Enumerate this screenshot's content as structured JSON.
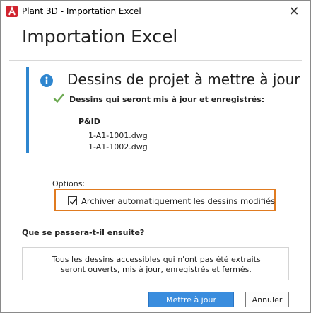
{
  "window": {
    "title": "Plant 3D - Importation Excel",
    "close_symbol": "✕"
  },
  "page_title": "Importation Excel",
  "info": {
    "heading": "Dessins de projet à mettre à jour",
    "check_label": "Dessins qui seront mis à jour et enregistrés:",
    "group_name": "P&ID",
    "drawings": [
      "1-A1-1001.dwg",
      "1-A1-1002.dwg"
    ]
  },
  "options": {
    "label": "Options:",
    "archive_checkbox": {
      "label": "Archiver automatiquement les dessins modifiés",
      "checked": true
    }
  },
  "next": {
    "heading": "Que se passera-t-il ensuite?",
    "line1": "Tous les dessins accessibles qui n'ont pas été extraits",
    "line2": "seront ouverts, mis à jour, enregistrés et fermés."
  },
  "buttons": {
    "update": "Mettre à jour",
    "cancel": "Annuler"
  },
  "icons": {
    "app": "autocad-plant3d-icon",
    "info": "info-icon",
    "check": "checkmark-icon",
    "checkbox_tick": "checkbox-tick-icon"
  },
  "colors": {
    "accent": "#2f86cf",
    "highlight": "#e07b20",
    "check_green": "#6aa84f",
    "app_red": "#d1242f",
    "primary_button": "#3a8dde"
  }
}
